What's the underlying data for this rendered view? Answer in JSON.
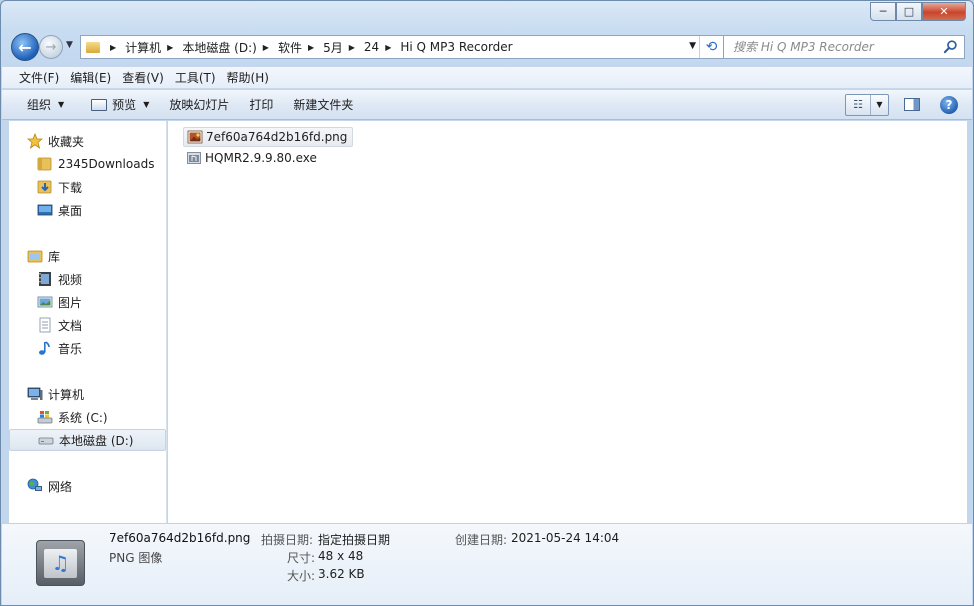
{
  "window": {
    "caption_buttons": {
      "minimize": "─",
      "maximize": "□",
      "close": "✕"
    }
  },
  "nav": {
    "back_glyph": "←",
    "forward_glyph": "→",
    "breadcrumbs": [
      "计算机",
      "本地磁盘 (D:)",
      "软件",
      "5月",
      "24",
      "Hi Q MP3 Recorder"
    ],
    "search_placeholder": "搜索 Hi Q MP3 Recorder"
  },
  "menu": [
    "文件(F)",
    "编辑(E)",
    "查看(V)",
    "工具(T)",
    "帮助(H)"
  ],
  "commands": {
    "organize": "组织",
    "preview": "预览",
    "slideshow": "放映幻灯片",
    "print": "打印",
    "new_folder": "新建文件夹"
  },
  "sidebar": {
    "favorites": {
      "label": "收藏夹",
      "items": [
        "2345Downloads",
        "下载",
        "桌面"
      ]
    },
    "libraries": {
      "label": "库",
      "items": [
        "视频",
        "图片",
        "文档",
        "音乐"
      ]
    },
    "computer": {
      "label": "计算机",
      "items": [
        "系统 (C:)",
        "本地磁盘 (D:)"
      ]
    },
    "network": {
      "label": "网络"
    },
    "selected": "本地磁盘 (D:)"
  },
  "files": [
    {
      "name": "7ef60a764d2b16fd.png",
      "icon": "png-image-icon",
      "selected": true
    },
    {
      "name": "HQMR2.9.9.80.exe",
      "icon": "exe-file-icon",
      "selected": false
    }
  ],
  "details": {
    "name": "7ef60a764d2b16fd.png",
    "type": "PNG 图像",
    "taken_label": "拍摄日期:",
    "taken_value": "指定拍摄日期",
    "size_label": "尺寸:",
    "size_value": "48 x 48",
    "filesize_label": "大小:",
    "filesize_value": "3.62 KB",
    "created_label": "创建日期:",
    "created_value": "2021-05-24 14:04"
  },
  "colors": {
    "accent": "#1f5fb8",
    "folder": "#e8c15b",
    "selection": "#e7ebf0"
  }
}
